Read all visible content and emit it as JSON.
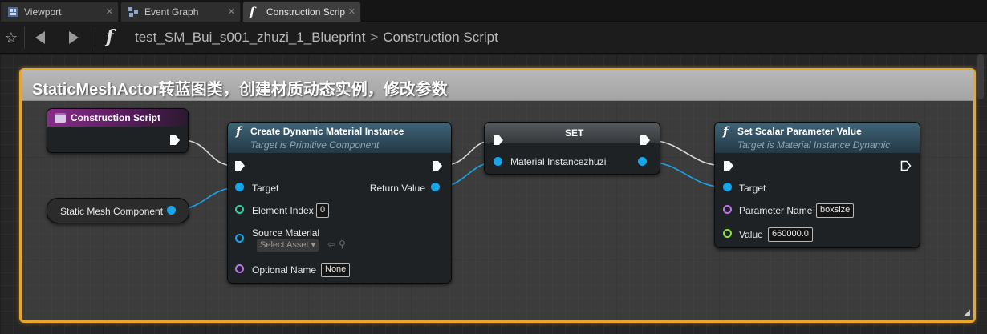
{
  "tabs": [
    {
      "label": "Viewport",
      "close": "✕"
    },
    {
      "label": "Event Graph",
      "close": "✕"
    },
    {
      "label": "Construction Scrip",
      "close": "✕"
    }
  ],
  "toolbar": {
    "breadcrumb_blueprint": "test_SM_Bui_s001_zhuzi_1_Blueprint",
    "breadcrumb_separator": ">",
    "breadcrumb_graph": "Construction Script"
  },
  "comment": {
    "title": "StaticMeshActor转蓝图类，创建材质动态实例，修改参数",
    "color": "#e8a62a"
  },
  "nodes": {
    "construction_script": {
      "title": "Construction Script"
    },
    "static_mesh_component": {
      "label": "Static Mesh Component"
    },
    "create_dmi": {
      "title": "Create Dynamic Material Instance",
      "subtitle": "Target is Primitive Component",
      "target": "Target",
      "return_value": "Return Value",
      "element_index_label": "Element Index",
      "element_index_value": "0",
      "source_material_label": "Source Material",
      "select_asset": "Select Asset",
      "optional_name_label": "Optional Name",
      "optional_name_value": "None"
    },
    "set": {
      "title": "SET",
      "variable": "Material Instancezhuzi"
    },
    "set_scalar": {
      "title": "Set Scalar Parameter Value",
      "subtitle": "Target is Material Instance Dynamic",
      "target": "Target",
      "parameter_name_label": "Parameter Name",
      "parameter_name_value": "boxsize",
      "value_label": "Value",
      "value_value": "660000.0"
    }
  },
  "colors": {
    "object_pin": "#17a6e8",
    "int_pin": "#35d0a0",
    "name_pin": "#c077e8",
    "float_pin": "#8fe03a",
    "event_header": "#7a1f7a",
    "function_header": "#2f4a5e"
  }
}
